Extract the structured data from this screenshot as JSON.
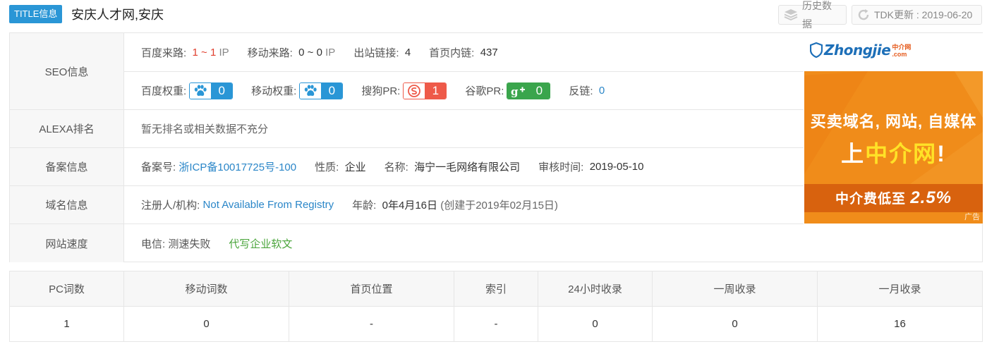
{
  "header": {
    "badge": "TITLE信息",
    "title": "安庆人才网,安庆",
    "history_label": "历史数据",
    "tdk_label": "TDK更新 : 2019-06-20"
  },
  "seo": {
    "label": "SEO信息",
    "baidu_source_key": "百度来路:",
    "baidu_source_value": "1 ~ 1",
    "baidu_source_unit": "IP",
    "mobile_source_key": "移动来路:",
    "mobile_source_value": "0 ~ 0",
    "mobile_source_unit": "IP",
    "outbound_key": "出站链接:",
    "outbound_value": "4",
    "inner_key": "首页内链:",
    "inner_value": "437",
    "baidu_weight_key": "百度权重:",
    "baidu_weight_value": "0",
    "mobile_weight_key": "移动权重:",
    "mobile_weight_value": "0",
    "sogou_key": "搜狗PR:",
    "sogou_value": "1",
    "google_key": "谷歌PR:",
    "google_value": "0",
    "backlink_key": "反链:",
    "backlink_value": "0"
  },
  "alexa": {
    "label": "ALEXA排名",
    "value": "暂无排名或相关数据不充分"
  },
  "icp": {
    "label": "备案信息",
    "number_key": "备案号:",
    "number_value": "浙ICP备10017725号-100",
    "nature_key": "性质:",
    "nature_value": "企业",
    "name_key": "名称:",
    "name_value": "海宁一毛网络有限公司",
    "review_key": "审核时间:",
    "review_value": "2019-05-10"
  },
  "domain": {
    "label": "域名信息",
    "registrant_key": "注册人/机构:",
    "registrant_value": "Not Available From Registry",
    "age_key": "年龄:",
    "age_value": "0年4月16日",
    "created_note": "(创建于2019年02月15日)"
  },
  "speed": {
    "label": "网站速度",
    "telecom": "电信: 测速失败",
    "link": "代写企业软文"
  },
  "ad": {
    "logo": "Zhongjie",
    "logo_sub": "中介网",
    "logo_com": ".com",
    "line1": "买卖域名, 网站, 自媒体",
    "line2_a": "上",
    "line2_b": "中介网",
    "line2_c": "!",
    "line3_a": "中介费低至",
    "line3_b": "2.5%",
    "tag": "广告"
  },
  "stats": {
    "headers": [
      "PC词数",
      "移动词数",
      "首页位置",
      "索引",
      "24小时收录",
      "一周收录",
      "一月收录"
    ],
    "values": [
      "1",
      "0",
      "-",
      "-",
      "0",
      "0",
      "16"
    ]
  },
  "colors": {
    "accent": "#2a96d6",
    "red": "#e03e2d",
    "green": "#4aa53b",
    "ad_orange": "#f08c1a"
  }
}
